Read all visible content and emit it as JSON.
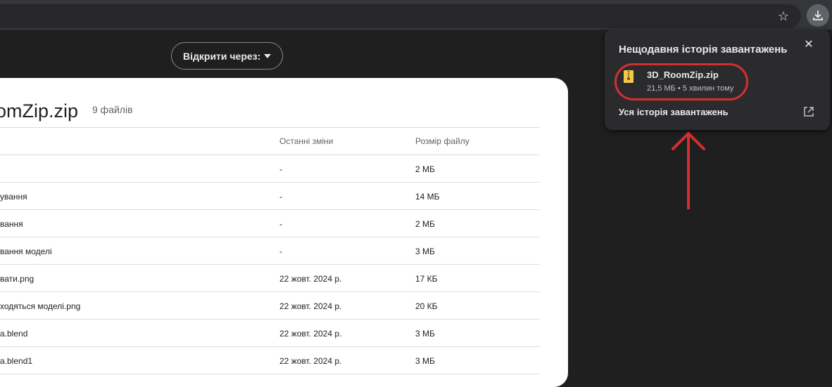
{
  "toolbar": {
    "bookmark_icon": "star-icon",
    "download_icon": "download-icon"
  },
  "viewer": {
    "open_with_label": "Відкрити через:",
    "archive_title": "omZip.zip",
    "file_count": "9 файлів",
    "columns": [
      "Останні зміни",
      "Розмір файлу"
    ],
    "rows": [
      {
        "name": "",
        "modified": "-",
        "size": "2 МБ"
      },
      {
        "name": "ування",
        "modified": "-",
        "size": "14 МБ"
      },
      {
        "name": "вання",
        "modified": "-",
        "size": "2 МБ"
      },
      {
        "name": "вання моделі",
        "modified": "-",
        "size": "3 МБ"
      },
      {
        "name": "вати.png",
        "modified": "22 жовт. 2024 р.",
        "size": "17 КБ"
      },
      {
        "name": "ходяться моделі.png",
        "modified": "22 жовт. 2024 р.",
        "size": "20 КБ"
      },
      {
        "name": "a.blend",
        "modified": "22 жовт. 2024 р.",
        "size": "3 МБ"
      },
      {
        "name": "a.blend1",
        "modified": "22 жовт. 2024 р.",
        "size": "3 МБ"
      }
    ]
  },
  "downloads_popup": {
    "title": "Нещодавня історія завантажень",
    "close_icon": "close-icon",
    "item": {
      "name": "3D_RoomZip.zip",
      "meta": "21,5 МБ • 5 хвилин тому",
      "icon": "zip-file-icon"
    },
    "history_label": "Уся історія завантажень",
    "history_icon": "open-in-new-icon"
  },
  "colors": {
    "highlight": "#d32f2f",
    "popup_bg": "#2b2b2d",
    "page_bg": "#1f1f1f"
  }
}
